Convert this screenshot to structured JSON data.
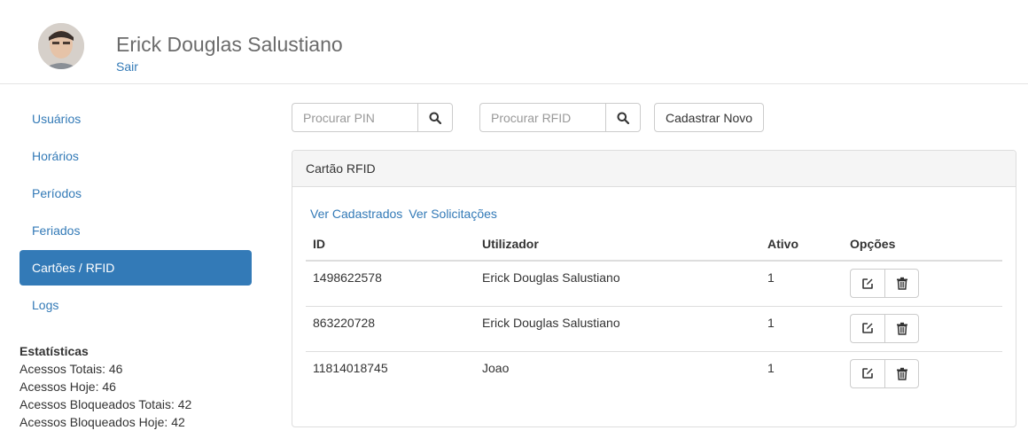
{
  "header": {
    "user_name": "Erick Douglas Salustiano",
    "logout_label": "Sair"
  },
  "sidebar": {
    "items": [
      {
        "label": "Usuários",
        "active": false
      },
      {
        "label": "Horários",
        "active": false
      },
      {
        "label": "Períodos",
        "active": false
      },
      {
        "label": "Feriados",
        "active": false
      },
      {
        "label": "Cartões / RFID",
        "active": true
      },
      {
        "label": "Logs",
        "active": false
      }
    ]
  },
  "stats": {
    "title": "Estatísticas",
    "lines": [
      "Acessos Totais: 46",
      "Acessos Hoje: 46",
      "Acessos Bloqueados Totais: 42",
      "Acessos Bloqueados Hoje: 42"
    ]
  },
  "toolbar": {
    "pin_placeholder": "Procurar PIN",
    "rfid_placeholder": "Procurar RFID",
    "new_label": "Cadastrar Novo"
  },
  "panel": {
    "title": "Cartão RFID",
    "link_registered": "Ver Cadastrados",
    "link_requests": "Ver Solicitações",
    "columns": [
      "ID",
      "Utilizador",
      "Ativo",
      "Opções"
    ],
    "rows": [
      {
        "id": "1498622578",
        "user": "Erick Douglas Salustiano",
        "active": "1"
      },
      {
        "id": "863220728",
        "user": "Erick Douglas Salustiano",
        "active": "1"
      },
      {
        "id": "11814018745",
        "user": "Joao",
        "active": "1"
      }
    ]
  },
  "colors": {
    "accent": "#337ab7",
    "panel_heading_bg": "#f5f5f5",
    "border": "#dddddd"
  },
  "icons": {
    "search": "search-icon",
    "edit": "edit-icon",
    "delete": "trash-icon"
  }
}
